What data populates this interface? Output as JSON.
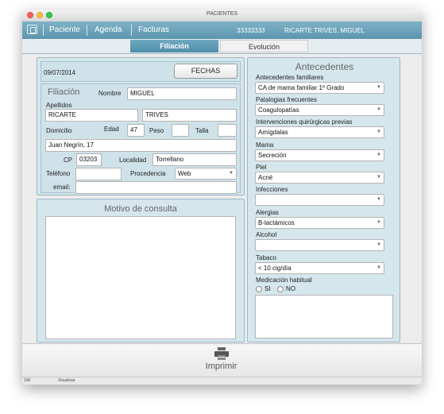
{
  "window": {
    "title": "PACIENTES"
  },
  "nav": {
    "paciente": "Paciente",
    "agenda": "Agenda",
    "facturas": "Facturas",
    "patient_id": "33333333",
    "patient_name": "RICARTE TRIVES, MIGUEL"
  },
  "tabs": {
    "filiacion": "Filiación",
    "evolucion": "Evolución"
  },
  "header": {
    "date": "09/07/2014",
    "fechas_button": "FECHAS"
  },
  "filiacion": {
    "title": "Filiación",
    "nombre_label": "Nombre",
    "nombre": "MIGUEL",
    "apellidos_label": "Apellidos",
    "apellido1": "RICARTE",
    "apellido2": "TRIVES",
    "domicilio_label": "Domicilio",
    "edad_label": "Edad",
    "edad": "47",
    "peso_label": "Peso",
    "peso": "",
    "talla_label": "Talla",
    "talla": "",
    "domicilio": "Juan Negrín, 17",
    "cp_label": "CP",
    "cp": "03203",
    "localidad_label": "Localidad",
    "localidad": "Torrellano",
    "telefono_label": "Teléfono",
    "telefono": "",
    "procedencia_label": "Procedencia",
    "procedencia": "Web",
    "email_label": "email:",
    "email": ""
  },
  "motivo": {
    "title": "Motivo de consulta",
    "text": ""
  },
  "antecedentes": {
    "title": "Antecedentes",
    "familiares_label": "Antecedentes familiares",
    "familiares": "CA de mama familiar 1º Grado",
    "patologias_label": "Patalogias frecuentes",
    "patologias": "Coagulopatías",
    "intervenciones_label": "Intervenciones quirúrgicas previas",
    "intervenciones": "Amígdalas",
    "mama_label": "Mama",
    "mama": "Secreción",
    "piel_label": "Piel",
    "piel": "Acné",
    "infecciones_label": "Infecciones",
    "infecciones": "",
    "alergias_label": "Alergias",
    "alergias": "B-lactámicos",
    "alcohol_label": "Alcohol",
    "alcohol": "",
    "tabaco_label": "Tabaco",
    "tabaco": "< 10 cig/día",
    "medicacion_label": "Medicación habitual",
    "si_label": "SI",
    "no_label": "NO"
  },
  "bottom": {
    "print_label": "Imprimir"
  },
  "status": {
    "zoom": "100",
    "mode": "Visualizar"
  }
}
